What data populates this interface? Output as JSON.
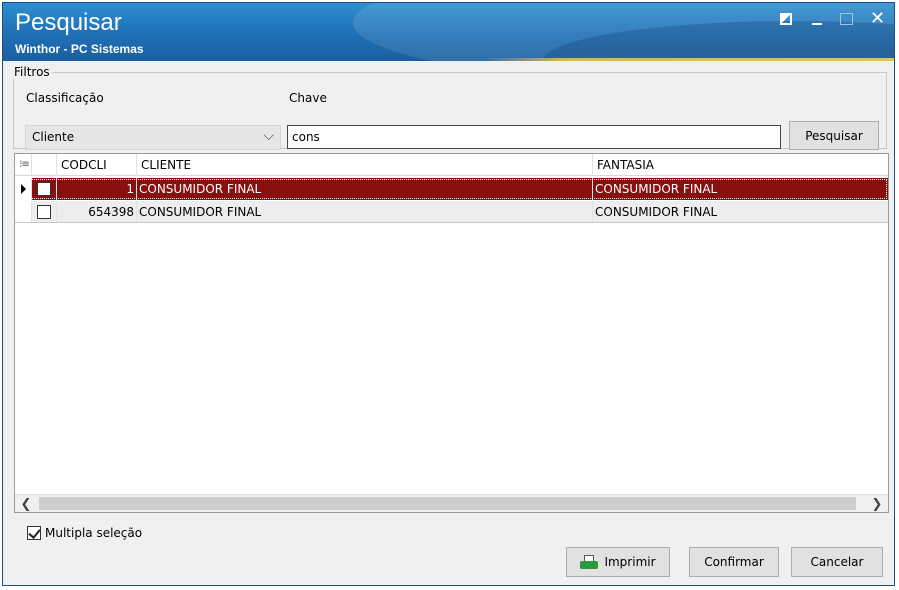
{
  "window": {
    "title": "Pesquisar",
    "subtitle": "Winthor - PC Sistemas"
  },
  "filters": {
    "legend": "Filtros",
    "classificacao_label": "Classificação",
    "classificacao_value": "Cliente",
    "chave_label": "Chave",
    "chave_value": "cons",
    "search_button": "Pesquisar"
  },
  "grid": {
    "columns": [
      "CODCLI",
      "CLIENTE",
      "FANTASIA"
    ],
    "rows": [
      {
        "codcli": "1",
        "cliente": "CONSUMIDOR FINAL",
        "fantasia": "CONSUMIDOR FINAL",
        "selected": true
      },
      {
        "codcli": "654398",
        "cliente": "CONSUMIDOR FINAL",
        "fantasia": "CONSUMIDOR FINAL",
        "selected": false
      }
    ]
  },
  "footer": {
    "multi_label": "Multipla seleção",
    "multi_checked": true,
    "print_button": "Imprimir",
    "confirm_button": "Confirmar",
    "cancel_button": "Cancelar"
  },
  "colors": {
    "title_bar": "#1f6fb6",
    "selected_row": "#8a0e0e",
    "accent_line": "#d8b660"
  },
  "icons": [
    "restore-icon",
    "minimize-icon",
    "maximize-icon",
    "close-icon",
    "column-chooser-icon",
    "row-indicator-icon",
    "chevron-down-icon",
    "printer-icon",
    "scroll-left-icon",
    "scroll-right-icon"
  ]
}
